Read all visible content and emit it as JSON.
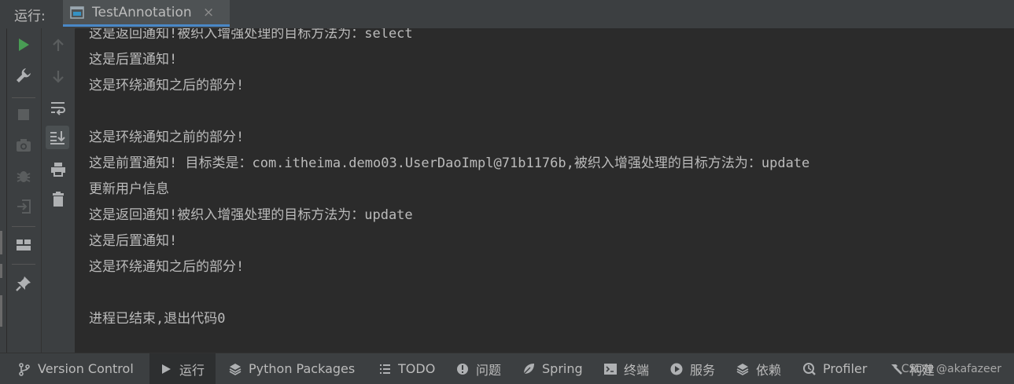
{
  "run_panel": {
    "label": "运行:",
    "tab": {
      "title": "TestAnnotation",
      "close_glyph": "×"
    }
  },
  "toolbar_left": [
    {
      "icon": "run-icon",
      "color": "#499c54"
    },
    {
      "icon": "wrench-icon",
      "color": "#afb1b3"
    },
    {
      "icon": "stop-icon",
      "color": "#5a5d5e"
    },
    {
      "icon": "camera-icon",
      "color": "#5a5d5e"
    },
    {
      "icon": "debug-icon",
      "color": "#5a5d5e"
    },
    {
      "icon": "login-icon",
      "color": "#5a5d5e"
    },
    {
      "icon": "layout-icon",
      "color": "#afb1b3"
    },
    {
      "icon": "pin-icon",
      "color": "#afb1b3"
    }
  ],
  "toolbar_right": [
    {
      "icon": "arrow-up-icon"
    },
    {
      "icon": "arrow-down-icon"
    },
    {
      "icon": "soft-wrap-icon"
    },
    {
      "icon": "scroll-to-end-icon"
    },
    {
      "icon": "print-icon"
    },
    {
      "icon": "trash-icon"
    }
  ],
  "console": {
    "lines": [
      "这是返回通知!被织入增强处理的目标方法为：select",
      "这是后置通知!",
      "这是环绕通知之后的部分!",
      "",
      "这是环绕通知之前的部分!",
      "这是前置通知! 目标类是：com.itheima.demo03.UserDaoImpl@71b1176b,被织入增强处理的目标方法为：update",
      "更新用户信息",
      "这是返回通知!被织入增强处理的目标方法为：update",
      "这是后置通知!",
      "这是环绕通知之后的部分!",
      "",
      "进程已结束,退出代码0"
    ]
  },
  "bottom_bar": {
    "items": [
      {
        "label": "Version Control",
        "icon": "branch-icon"
      },
      {
        "label": "运行",
        "icon": "run-icon"
      },
      {
        "label": "Python Packages",
        "icon": "layers-icon"
      },
      {
        "label": "TODO",
        "icon": "list-icon"
      },
      {
        "label": "问题",
        "icon": "problems-icon"
      },
      {
        "label": "Spring",
        "icon": "spring-leaf-icon"
      },
      {
        "label": "终端",
        "icon": "terminal-icon"
      },
      {
        "label": "服务",
        "icon": "services-icon"
      },
      {
        "label": "依赖",
        "icon": "layers-icon"
      },
      {
        "label": "Profiler",
        "icon": "profiler-icon"
      },
      {
        "label": "构建",
        "icon": "hammer-icon"
      }
    ],
    "watermark": "CSDN @akafazeer"
  },
  "colors": {
    "panel": "#3c3f41",
    "console_bg": "#2b2b2b",
    "text": "#bbbbbb",
    "tab_underline": "#4a88c7",
    "run_green": "#499c54"
  }
}
